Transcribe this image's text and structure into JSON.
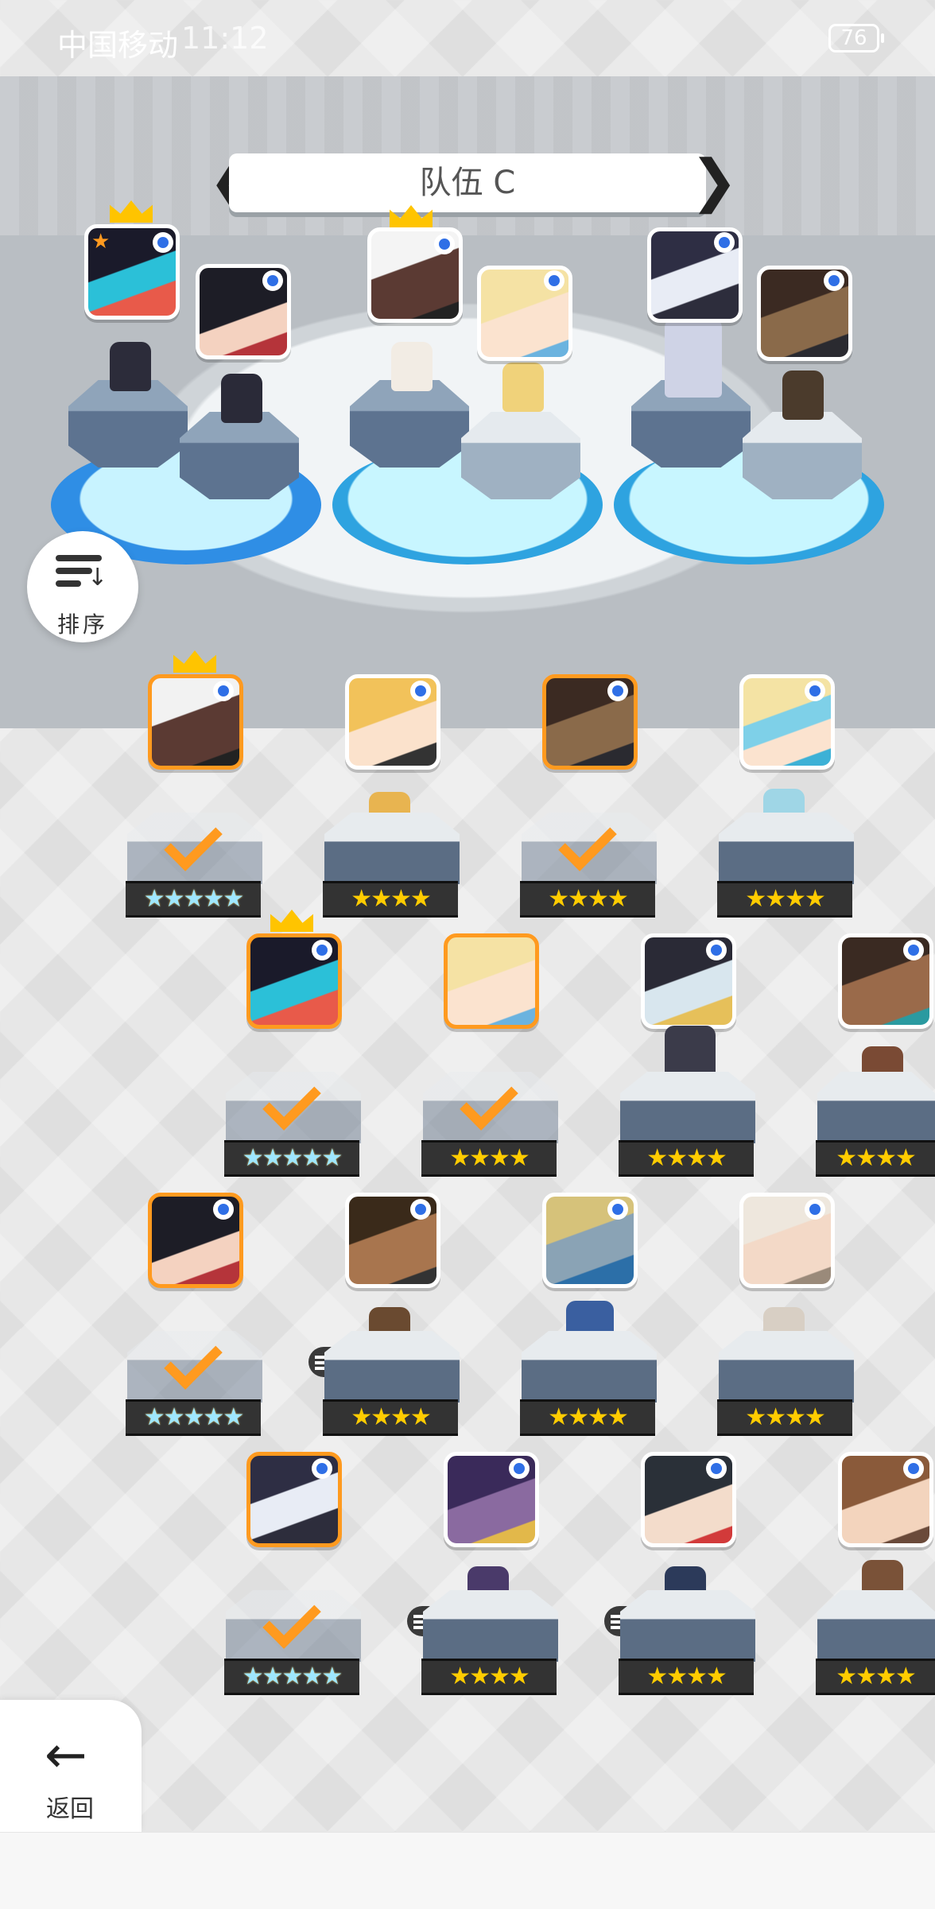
{
  "status_bar": {
    "carrier": "中国移动",
    "time": "11:12",
    "battery": "76"
  },
  "team": {
    "name": "队伍 C",
    "prev_arrow": "❮",
    "next_arrow": "❯"
  },
  "sort_button": {
    "label": "排序"
  },
  "back_button": {
    "label": "返回",
    "arrow": "←"
  },
  "icons": [
    "sort-icon",
    "back-arrow-icon",
    "crown-icon",
    "checkmark-icon",
    "stack-icon",
    "online-dot-icon"
  ],
  "colors": {
    "selected_border": "#ff9a1f",
    "crown": "#ffc400",
    "star": "#ffcc00",
    "online_dot": "#2f6fe6"
  },
  "team_slots": [
    {
      "hero": "hero-black-hair-red",
      "leader": true,
      "leader_star": "★"
    },
    {
      "hero": "hero-black-hair-bangs",
      "leader": false
    },
    {
      "hero": "hero-white-hair",
      "leader": true
    },
    {
      "hero": "hero-blonde",
      "leader": false
    },
    {
      "hero": "hero-dark-armor",
      "leader": false
    },
    {
      "hero": "hero-hooded-grin",
      "leader": false
    }
  ],
  "heroes": [
    {
      "stars": "★★★★★",
      "rainbow": true,
      "selected": true,
      "crown": true
    },
    {
      "stars": "★★★★",
      "rainbow": false,
      "selected": false
    },
    {
      "stars": "★★★★",
      "rainbow": false,
      "selected": true
    },
    {
      "stars": "★★★★",
      "rainbow": false,
      "selected": false
    },
    {
      "stars": "★★★★★",
      "rainbow": true,
      "selected": true,
      "crown": true
    },
    {
      "stars": "★★★★",
      "rainbow": false,
      "selected": true
    },
    {
      "stars": "★★★★",
      "rainbow": false,
      "selected": false
    },
    {
      "stars": "★★★★",
      "rainbow": false,
      "selected": false
    },
    {
      "stars": "★★★★★",
      "rainbow": true,
      "selected": true
    },
    {
      "stars": "★★★★",
      "rainbow": false,
      "selected": false,
      "stack": "1"
    },
    {
      "stars": "★★★★",
      "rainbow": false,
      "selected": false
    },
    {
      "stars": "★★★★",
      "rainbow": false,
      "selected": false
    },
    {
      "stars": "★★★★★",
      "rainbow": true,
      "selected": true
    },
    {
      "stars": "★★★★",
      "rainbow": false,
      "selected": false,
      "stack": "2"
    },
    {
      "stars": "★★★★",
      "rainbow": false,
      "selected": false,
      "stack": "2"
    },
    {
      "stars": "★★★★",
      "rainbow": false,
      "selected": false
    }
  ]
}
